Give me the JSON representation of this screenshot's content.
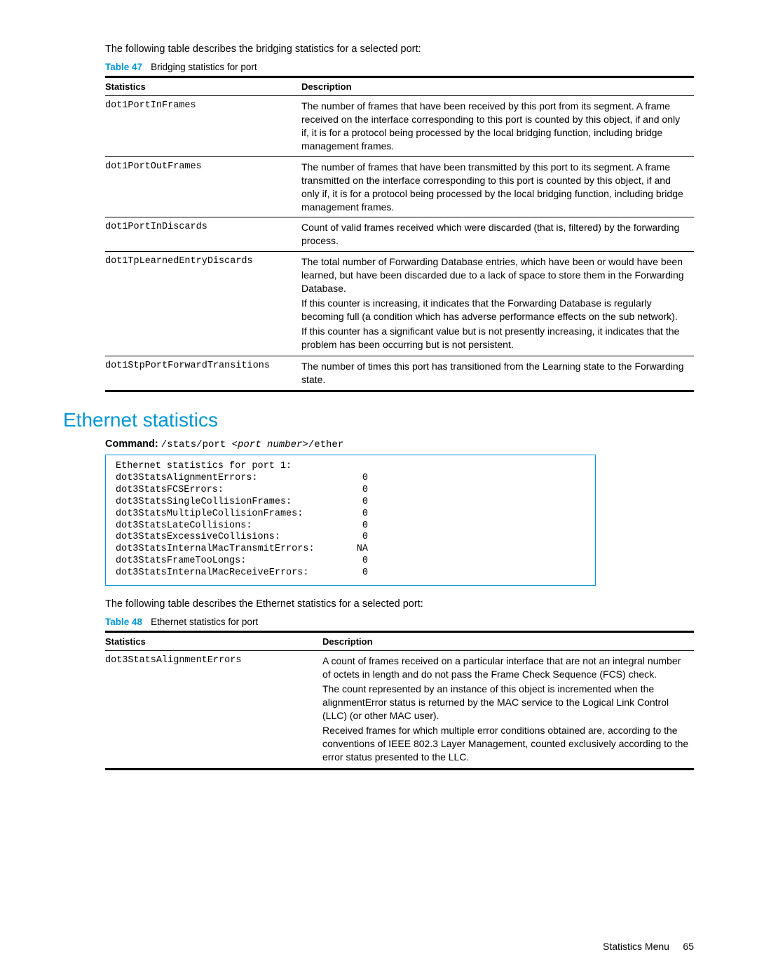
{
  "intro47": "The following table describes the bridging statistics for a selected port:",
  "table47": {
    "label": "Table 47",
    "title": "Bridging statistics for port",
    "headers": {
      "col1": "Statistics",
      "col2": "Description"
    },
    "rows": [
      {
        "stat": "dot1PortInFrames",
        "desc": "The number of frames that have been received by this port from its segment. A frame received on the interface corresponding to this port is counted by this object, if and only if, it is for a protocol being processed by the local bridging function, including bridge management frames."
      },
      {
        "stat": "dot1PortOutFrames",
        "desc": "The number of frames that have been transmitted by this port to its segment. A frame transmitted on the interface corresponding to this port is counted by this object, if and only if, it is for a protocol being processed by the local bridging function, including bridge management frames."
      },
      {
        "stat": "dot1PortInDiscards",
        "desc": "Count of valid frames received which were discarded (that is, filtered) by the forwarding process."
      },
      {
        "stat": "dot1TpLearnedEntryDiscards",
        "desc_p1": "The total number of Forwarding Database entries, which have been or would have been learned, but have been discarded due to a lack of space to store them in the Forwarding Database.",
        "desc_p2": "If this counter is increasing, it indicates that the Forwarding Database is regularly becoming full (a condition which has adverse performance effects on the sub network).",
        "desc_p3": "If this counter has a significant value but is not presently increasing, it indicates that the problem has been occurring but is not persistent."
      },
      {
        "stat": "dot1StpPortForwardTransitions",
        "desc": "The number of times this port has transitioned from the Learning state to the Forwarding state."
      }
    ]
  },
  "section_heading": "Ethernet statistics",
  "command": {
    "label": "Command:",
    "prefix": "/stats/port ",
    "param": "<port number>",
    "suffix": "/ether"
  },
  "output": {
    "title": "Ethernet statistics for port 1:",
    "lines": [
      {
        "l": "dot3StatsAlignmentErrors:",
        "v": "0"
      },
      {
        "l": "dot3StatsFCSErrors:",
        "v": "0"
      },
      {
        "l": "dot3StatsSingleCollisionFrames:",
        "v": "0"
      },
      {
        "l": "dot3StatsMultipleCollisionFrames:",
        "v": "0"
      },
      {
        "l": "dot3StatsLateCollisions:",
        "v": "0"
      },
      {
        "l": "dot3StatsExcessiveCollisions:",
        "v": "0"
      },
      {
        "l": "dot3StatsInternalMacTransmitErrors:",
        "v": "NA"
      },
      {
        "l": "dot3StatsFrameTooLongs:",
        "v": "0"
      },
      {
        "l": "dot3StatsInternalMacReceiveErrors:",
        "v": "0"
      }
    ]
  },
  "intro48": "The following table describes the Ethernet statistics for a selected port:",
  "table48": {
    "label": "Table 48",
    "title": "Ethernet statistics for port",
    "headers": {
      "col1": "Statistics",
      "col2": "Description"
    },
    "rows": [
      {
        "stat": "dot3StatsAlignmentErrors",
        "desc_p1": "A count of frames received on a particular interface that are not an integral number of octets in length and do not pass the Frame Check Sequence (FCS) check.",
        "desc_p2": "The count represented by an instance of this object is incremented when the alignmentError status is returned by the MAC service to the Logical Link Control (LLC) (or other MAC user).",
        "desc_p3": "Received frames for which multiple error conditions obtained are, according to the conventions of IEEE 802.3 Layer Management, counted exclusively according to the error status presented to the LLC."
      }
    ]
  },
  "footer": {
    "section": "Statistics Menu",
    "page": "65"
  }
}
